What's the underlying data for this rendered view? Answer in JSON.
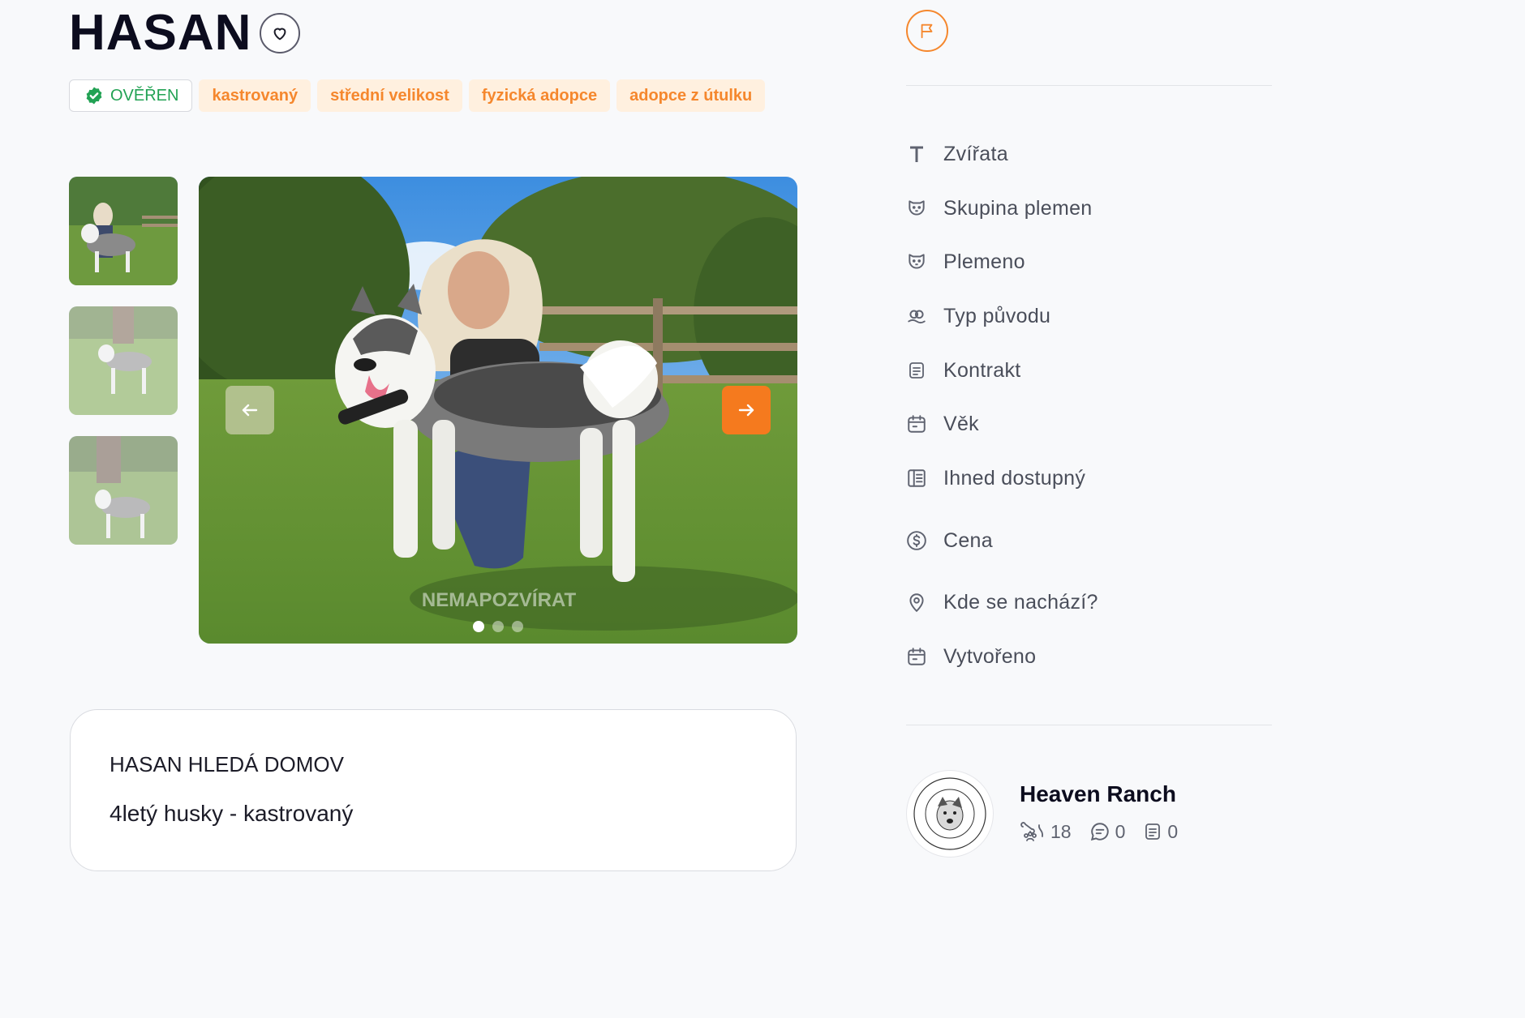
{
  "pet": {
    "name": "HASAN"
  },
  "tags": {
    "verified": "OVĚŘEN",
    "items": [
      "kastrovaný",
      "střední velikost",
      "fyzická adopce",
      "adopce z útulku"
    ]
  },
  "gallery": {
    "watermark": "NEMAPOZVÍRAT",
    "slides": 3,
    "active_slide": 1
  },
  "description": {
    "heading": "HASAN HLEDÁ DOMOV",
    "text": "4letý husky - kastrovaný"
  },
  "attributes": [
    {
      "icon": "text-t-icon",
      "label": "Zvířata"
    },
    {
      "icon": "dog-face-icon",
      "label": "Skupina plemen"
    },
    {
      "icon": "dog-face-icon",
      "label": "Plemeno"
    },
    {
      "icon": "pedigree-icon",
      "label": "Typ původu"
    },
    {
      "icon": "document-icon",
      "label": "Kontrakt"
    },
    {
      "icon": "calendar-icon",
      "label": "Věk"
    },
    {
      "icon": "list-icon",
      "label": "Ihned dostupný"
    },
    {
      "icon": "dollar-icon",
      "label": "Cena"
    },
    {
      "icon": "location-pin-icon",
      "label": "Kde se nachází?"
    },
    {
      "icon": "calendar-icon",
      "label": "Vytvořeno"
    }
  ],
  "shelter": {
    "name": "Heaven Ranch",
    "stats": {
      "animals": "18",
      "comments": "0",
      "posts": "0"
    }
  },
  "colors": {
    "accent": "#f5872d",
    "verified": "#22a254",
    "tag_bg": "#fff0df"
  }
}
